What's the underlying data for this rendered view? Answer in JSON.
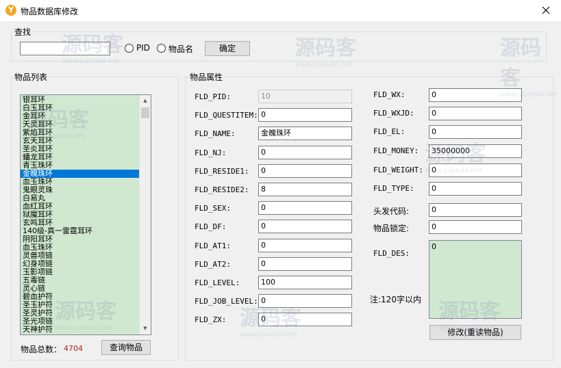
{
  "window": {
    "title": "物品数据库修改",
    "app_icon": "Y"
  },
  "search": {
    "group_label": "查找",
    "input_value": "",
    "radio_pid_label": "PID",
    "radio_name_label": "物品名",
    "confirm_label": "确定"
  },
  "item_list": {
    "group_label": "物品列表",
    "items": [
      "银耳环",
      "白玉耳环",
      "金耳环",
      "天灵耳环",
      "紫焰耳环",
      "玄天耳环",
      "圣炎耳环",
      "蟠龙耳环",
      "青玉珠环",
      "金魄珠环",
      "血玉珠环",
      "鬼眼灵珠",
      "白易丸",
      "血红耳环",
      "狱魔耳环",
      "玄鸣耳环",
      "140级-真一雷霆耳环",
      "阴阳耳环",
      "血玉珠环",
      "灵兽项链",
      "幻身项链",
      "玉影项链",
      "五毒链",
      "灵心链",
      "碧血护符",
      "圣玉护符",
      "圣灵护符",
      "圣光项链",
      "天神护符"
    ],
    "selected_index": 9,
    "count_label": "物品总数：",
    "count_value": "4704",
    "query_button": "查询物品"
  },
  "properties": {
    "group_label": "物品属性",
    "left_fields": [
      {
        "label": "FLD_PID:",
        "value": "10"
      },
      {
        "label": "FLD_QUESTITEM:",
        "value": "0"
      },
      {
        "label": "FLD_NAME:",
        "value": "金魄珠环"
      },
      {
        "label": "FLD_NJ:",
        "value": "0"
      },
      {
        "label": "FLD_RESIDE1:",
        "value": "0"
      },
      {
        "label": "FLD_RESIDE2:",
        "value": "8"
      },
      {
        "label": "FLD_SEX:",
        "value": "0"
      },
      {
        "label": "FLD_DF:",
        "value": "0"
      },
      {
        "label": "FLD_AT1:",
        "value": "0"
      },
      {
        "label": "FLD_AT2:",
        "value": "0"
      },
      {
        "label": "FLD_LEVEL:",
        "value": "100"
      },
      {
        "label": "FLD_JOB_LEVEL:",
        "value": "0"
      },
      {
        "label": "FLD_ZX:",
        "value": "0"
      }
    ],
    "right_fields": [
      {
        "label": "FLD_WX:",
        "value": "0"
      },
      {
        "label": "FLD_WXJD:",
        "value": "0"
      },
      {
        "label": "FLD_EL:",
        "value": "0"
      },
      {
        "label": "FLD_MONEY:",
        "value": "35000000"
      },
      {
        "label": "FLD_WEIGHT:",
        "value": "0"
      },
      {
        "label": "FLD_TYPE:",
        "value": "0"
      },
      {
        "label": "头发代码:",
        "value": "0"
      },
      {
        "label": "物品锁定:",
        "value": "0"
      }
    ],
    "des_label": "FLD_DES:",
    "des_value": "0",
    "note": "注:120字以内",
    "modify_button": "修改(重读物品)"
  },
  "watermark": {
    "text": "源码客",
    "url": "www.yuandd.net"
  },
  "colors": {
    "list_bg": "#cfe8cf",
    "selection": "#0078d7",
    "count": "#b22222"
  }
}
